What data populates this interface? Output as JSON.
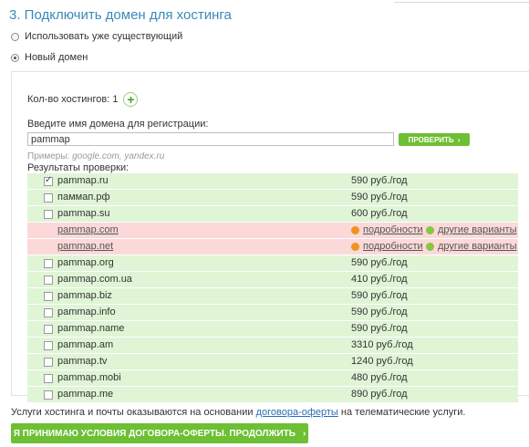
{
  "section_title": "3. Подключить домен для хостинга",
  "options": {
    "existing_label": "Использовать уже существующий",
    "new_label": "Новый домен",
    "selected": "new"
  },
  "hosting_count": {
    "label": "Кол-во хостингов: 1",
    "add_icon": "plus-icon"
  },
  "domain_form": {
    "label": "Введите имя домена для регистрации:",
    "value": "pammap",
    "check_button": "ПРОВЕРИТЬ",
    "check_button_icon": "›",
    "examples_prefix": "Примеры:",
    "examples_values": "google.com, yandex.ru"
  },
  "results": {
    "label": "Результаты проверки:",
    "details_label": "подробности",
    "variants_label": "другие варианты",
    "rows": [
      {
        "domain": "pammap.ru",
        "status": "available",
        "checked": true,
        "price": "590 руб./год"
      },
      {
        "domain": "паммап.рф",
        "status": "available",
        "checked": false,
        "price": "590 руб./год"
      },
      {
        "domain": "pammap.su",
        "status": "available",
        "checked": false,
        "price": "600 руб./год"
      },
      {
        "domain": "pammap.com",
        "status": "taken"
      },
      {
        "domain": "pammap.net",
        "status": "taken"
      },
      {
        "domain": "pammap.org",
        "status": "available",
        "checked": false,
        "price": "590 руб./год"
      },
      {
        "domain": "pammap.com.ua",
        "status": "available",
        "checked": false,
        "price": "410 руб./год"
      },
      {
        "domain": "pammap.biz",
        "status": "available",
        "checked": false,
        "price": "590 руб./год"
      },
      {
        "domain": "pammap.info",
        "status": "available",
        "checked": false,
        "price": "590 руб./год"
      },
      {
        "domain": "pammap.name",
        "status": "available",
        "checked": false,
        "price": "590 руб./год"
      },
      {
        "domain": "pammap.am",
        "status": "available",
        "checked": false,
        "price": "3310 руб./год"
      },
      {
        "domain": "pammap.tv",
        "status": "available",
        "checked": false,
        "price": "1240 руб./год"
      },
      {
        "domain": "pammap.mobi",
        "status": "available",
        "checked": false,
        "price": "480 руб./год"
      },
      {
        "domain": "pammap.me",
        "status": "available",
        "checked": false,
        "price": "890 руб./год"
      }
    ]
  },
  "footer": {
    "note_before": "Услуги хостинга и почты оказываются на основании ",
    "note_link": "договора-оферты",
    "note_after": " на телематические услуги.",
    "accept_button": "Я ПРИНИМАЮ УСЛОВИЯ ДОГОВОРА-ОФЕРТЫ. ПРОДОЛЖИТЬ",
    "accept_button_icon": "›"
  },
  "colors": {
    "title": "#3a89b8",
    "button_green": "#6dbf34",
    "row_available": "#dff5d6",
    "row_taken": "#fbd9d9",
    "dot_orange": "#f0931d",
    "dot_green": "#86c743",
    "link": "#2a6fb4"
  }
}
